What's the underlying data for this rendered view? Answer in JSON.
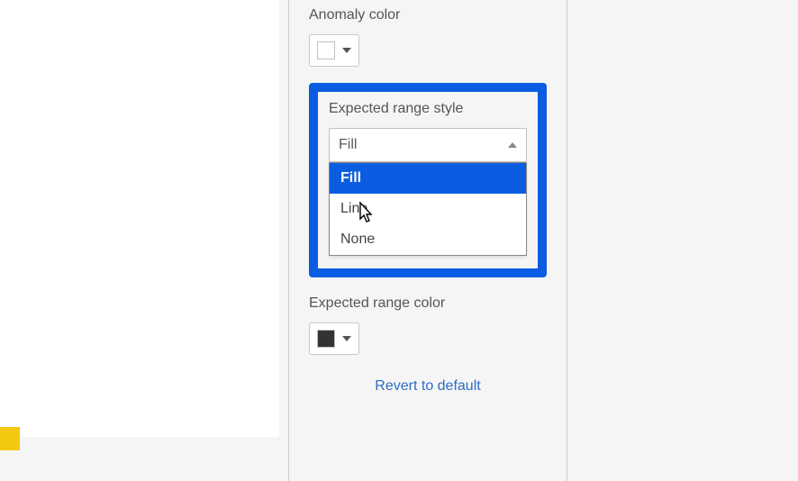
{
  "panel": {
    "anomaly_color_label": "Anomaly color",
    "anomaly_color_value": "#ffffff",
    "expected_range_style_label": "Expected range style",
    "expected_range_style_selected": "Fill",
    "expected_range_style_options": [
      "Fill",
      "Line",
      "None"
    ],
    "expected_range_color_label": "Expected range color",
    "expected_range_color_value": "#333333",
    "revert_label": "Revert to default"
  },
  "colors": {
    "highlight_border": "#0a5de1",
    "dropdown_selected_bg": "#0a5de1",
    "accent_yellow": "#f2c811"
  }
}
